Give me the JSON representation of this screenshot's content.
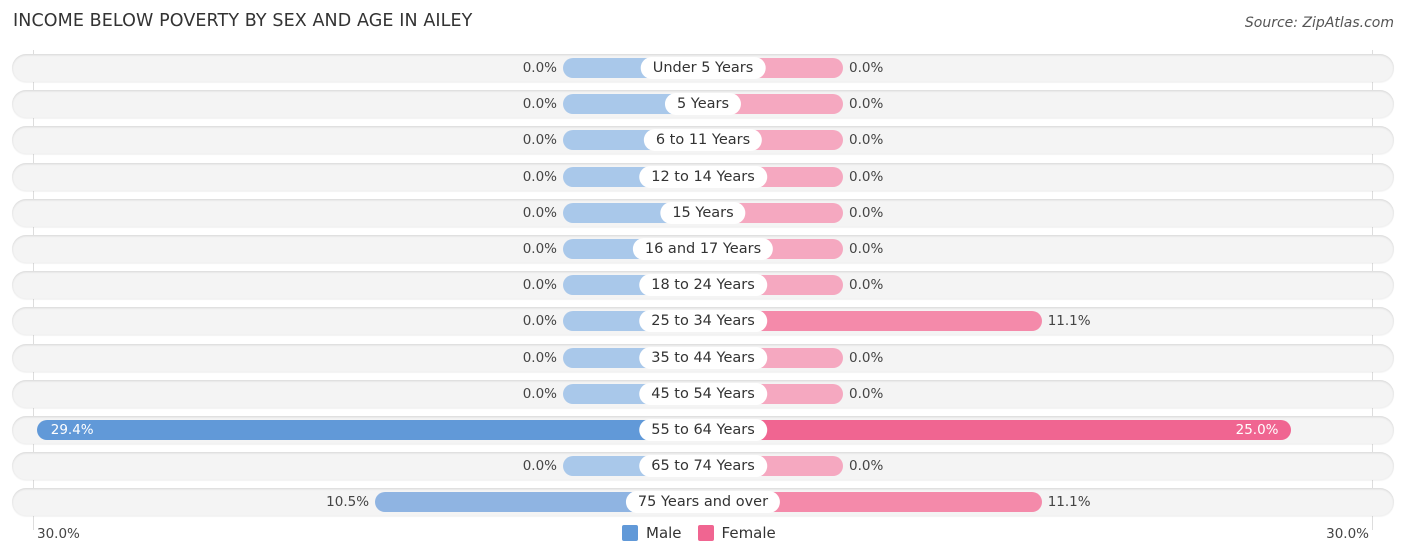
{
  "title": "INCOME BELOW POVERTY BY SEX AND AGE IN AILEY",
  "source": "Source: ZipAtlas.com",
  "colors": {
    "male": "#6199d8",
    "male_light": "#a9c8ea",
    "female": "#f06591",
    "female_light": "#f5a8c0",
    "row_bg": "#f4f4f4"
  },
  "chart_data": {
    "type": "bar",
    "orientation": "horizontal-diverging",
    "title": "INCOME BELOW POVERTY BY SEX AND AGE IN AILEY",
    "categories": [
      "Under 5 Years",
      "5 Years",
      "6 to 11 Years",
      "12 to 14 Years",
      "15 Years",
      "16 and 17 Years",
      "18 to 24 Years",
      "25 to 34 Years",
      "35 to 44 Years",
      "45 to 54 Years",
      "55 to 64 Years",
      "65 to 74 Years",
      "75 Years and over"
    ],
    "series": [
      {
        "name": "Male",
        "values": [
          0.0,
          0.0,
          0.0,
          0.0,
          0.0,
          0.0,
          0.0,
          0.0,
          0.0,
          0.0,
          29.4,
          0.0,
          10.5
        ],
        "labels": [
          "0.0%",
          "0.0%",
          "0.0%",
          "0.0%",
          "0.0%",
          "0.0%",
          "0.0%",
          "0.0%",
          "0.0%",
          "0.0%",
          "29.4%",
          "0.0%",
          "10.5%"
        ]
      },
      {
        "name": "Female",
        "values": [
          0.0,
          0.0,
          0.0,
          0.0,
          0.0,
          0.0,
          0.0,
          11.1,
          0.0,
          0.0,
          25.0,
          0.0,
          11.1
        ],
        "labels": [
          "0.0%",
          "0.0%",
          "0.0%",
          "0.0%",
          "0.0%",
          "0.0%",
          "0.0%",
          "11.1%",
          "0.0%",
          "0.0%",
          "25.0%",
          "0.0%",
          "11.1%"
        ]
      }
    ],
    "xlim": [
      -30,
      30
    ],
    "axis_labels": {
      "left": "30.0%",
      "right": "30.0%"
    },
    "unit": "%",
    "legend": {
      "position": "bottom-center",
      "entries": [
        "Male",
        "Female"
      ]
    },
    "grid": false
  }
}
